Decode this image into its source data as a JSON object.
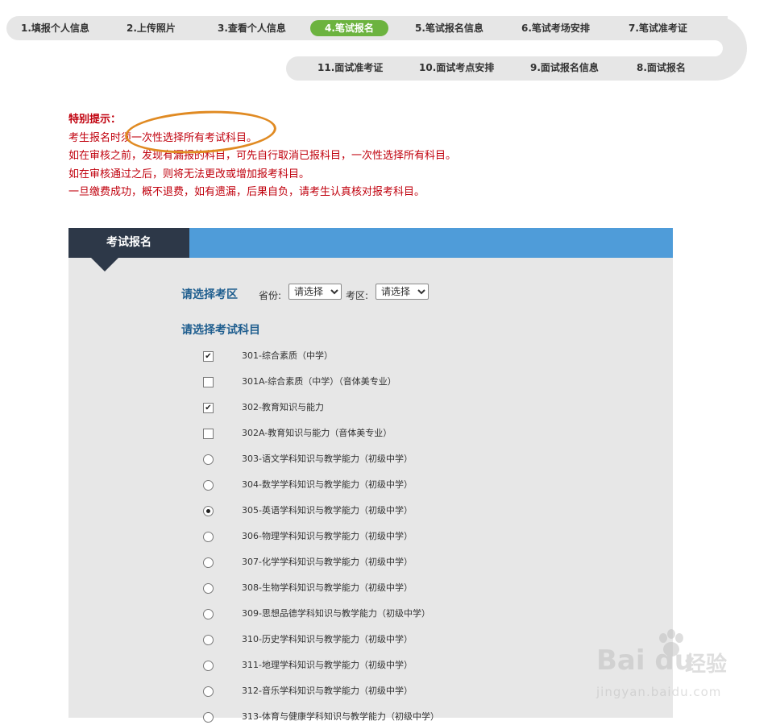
{
  "steps": {
    "row1": [
      "1.填报个人信息",
      "2.上传照片",
      "3.查看个人信息",
      "4.笔试报名",
      "5.笔试报名信息",
      "6.笔试考场安排",
      "7.笔试准考证"
    ],
    "row2": [
      "11.面试准考证",
      "10.面试考点安排",
      "9.面试报名信息",
      "8.面试报名"
    ],
    "active": "4.笔试报名"
  },
  "notice": {
    "title": "特别提示：",
    "lines": [
      "考生报名时须一次性选择所有考试科目。",
      "如在审核之前，发现有漏报的科目，可先自行取消已报科目，一次性选择所有科目。",
      "如在审核通过之后，则将无法更改或增加报考科目。",
      "一旦缴费成功，概不退费，如有遗漏，后果自负，请考生认真核对报考科目。"
    ]
  },
  "panel": {
    "tab_label": "考试报名",
    "area_title": "请选择考区",
    "province_label": "省份:",
    "province_value": "请选择",
    "district_label": "考区:",
    "district_value": "请选择",
    "subject_title": "请选择考试科目",
    "subjects": [
      {
        "label": "301-综合素质（中学）",
        "type": "checkbox",
        "checked": true
      },
      {
        "label": "301A-综合素质（中学）（音体美专业）",
        "type": "checkbox",
        "checked": false
      },
      {
        "label": "302-教育知识与能力",
        "type": "checkbox",
        "checked": true
      },
      {
        "label": "302A-教育知识与能力（音体美专业）",
        "type": "checkbox",
        "checked": false
      },
      {
        "label": "303-语文学科知识与教学能力（初级中学）",
        "type": "radio",
        "checked": false
      },
      {
        "label": "304-数学学科知识与教学能力（初级中学）",
        "type": "radio",
        "checked": false
      },
      {
        "label": "305-英语学科知识与教学能力（初级中学）",
        "type": "radio",
        "checked": true
      },
      {
        "label": "306-物理学科知识与教学能力（初级中学）",
        "type": "radio",
        "checked": false
      },
      {
        "label": "307-化学学科知识与教学能力（初级中学）",
        "type": "radio",
        "checked": false
      },
      {
        "label": "308-生物学科知识与教学能力（初级中学）",
        "type": "radio",
        "checked": false
      },
      {
        "label": "309-思想品德学科知识与教学能力（初级中学）",
        "type": "radio",
        "checked": false
      },
      {
        "label": "310-历史学科知识与教学能力（初级中学）",
        "type": "radio",
        "checked": false
      },
      {
        "label": "311-地理学科知识与教学能力（初级中学）",
        "type": "radio",
        "checked": false
      },
      {
        "label": "312-音乐学科知识与教学能力（初级中学）",
        "type": "radio",
        "checked": false
      },
      {
        "label": "313-体育与健康学科知识与教学能力（初级中学）",
        "type": "radio",
        "checked": false
      }
    ]
  },
  "watermark": {
    "brand": "Bai du",
    "suffix": "经验",
    "url": "jingyan.baidu.com"
  },
  "colors": {
    "nav_bg": "#e6e6e6",
    "active_step": "#6cb33f",
    "notice_red": "#c0000d",
    "annotation_circle": "#e08a22",
    "panel_header": "#4f9cd9",
    "panel_tab": "#2d3848",
    "section_title": "#1f5e8f"
  }
}
